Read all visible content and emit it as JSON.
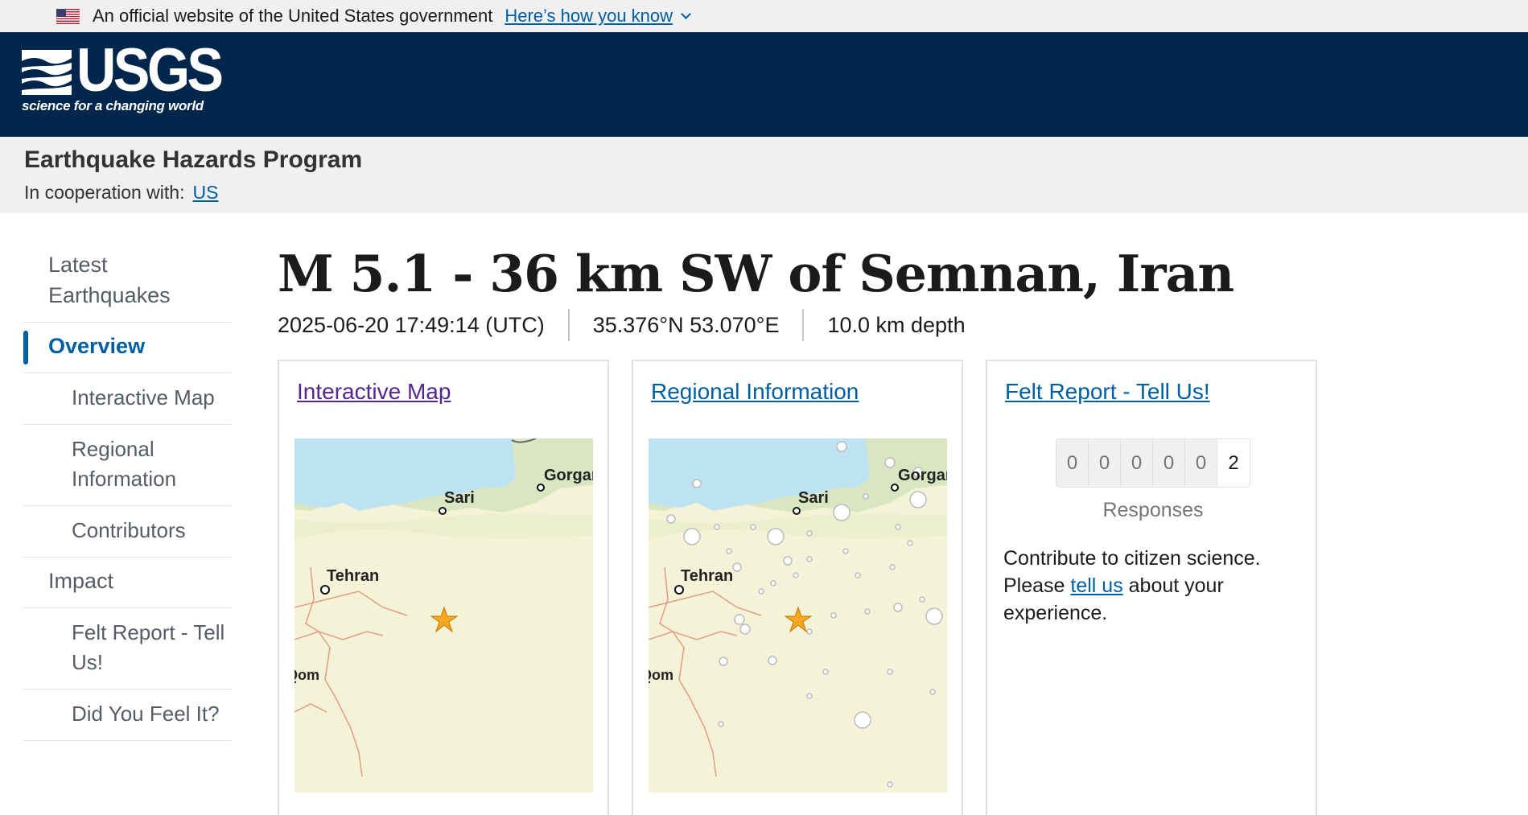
{
  "gov_banner": {
    "text": "An official website of the United States government",
    "link": "Here’s how you know"
  },
  "header": {
    "logo_text": "USGS",
    "tagline": "science for a changing world",
    "brand_color": "#00264c"
  },
  "program": {
    "title": "Earthquake Hazards Program",
    "coop_label": "In cooperation with:",
    "coop_link": "US"
  },
  "sidebar": {
    "items": [
      {
        "label": "Latest Earthquakes"
      },
      {
        "label": "Overview"
      },
      {
        "label": "Interactive Map"
      },
      {
        "label": "Regional Information"
      },
      {
        "label": "Contributors"
      },
      {
        "label": "Impact"
      },
      {
        "label": "Felt Report - Tell Us!"
      },
      {
        "label": "Did You Feel It?"
      }
    ]
  },
  "event": {
    "title": "M 5.1 - 36 km SW of Semnan, Iran",
    "time": "2025-06-20 17:49:14 (UTC)",
    "location": "35.376°N 53.070°E",
    "depth": "10.0 km depth"
  },
  "cards": {
    "interactive_map": {
      "link": "Interactive Map"
    },
    "regional": {
      "link": "Regional Information"
    },
    "felt": {
      "link": "Felt Report - Tell Us!",
      "digits": [
        "0",
        "0",
        "0",
        "0",
        "0",
        "2"
      ],
      "responses_label": "Responses",
      "text_before": "Contribute to citizen science. Please ",
      "text_link": "tell us",
      "text_after": " about your experience."
    }
  },
  "map_labels": {
    "gorgan": "Gorgan",
    "sari": "Sari",
    "tehran": "Tehran",
    "qom": "Qom"
  },
  "colors": {
    "link": "#005ea2",
    "visited": "#54278f",
    "sea": "#bde3f2",
    "land": "#f5f3d7",
    "vegetation": "#e4eccb",
    "epicenter_star": "#f5a623"
  }
}
